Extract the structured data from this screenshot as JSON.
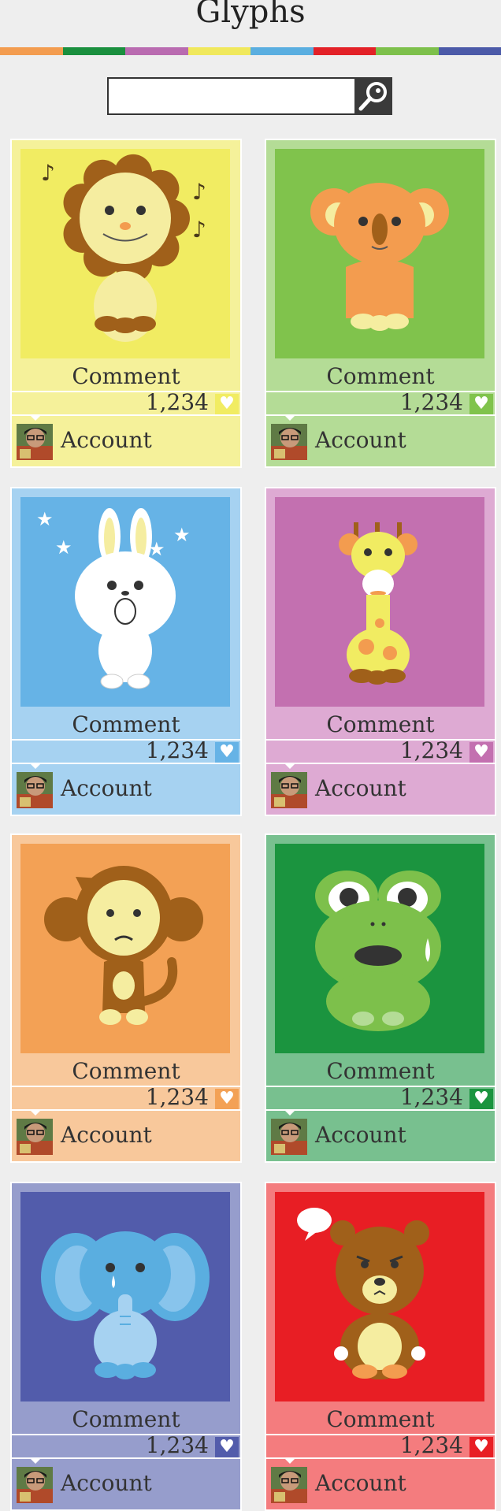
{
  "header": {
    "title": "Glyphs"
  },
  "stripe_colors": [
    "#f39c4f",
    "#1a8f3e",
    "#b96bb0",
    "#f0e85c",
    "#5aaee0",
    "#e32127",
    "#7dc04b",
    "#4b5aa8"
  ],
  "search": {
    "placeholder": "",
    "button_icon": "search-magnifier-icon"
  },
  "cards": [
    {
      "animal": "lion",
      "comment": "Comment",
      "count": "1,234",
      "account": "Account",
      "heart_icon": "heart-icon"
    },
    {
      "animal": "koala",
      "comment": "Comment",
      "count": "1,234",
      "account": "Account",
      "heart_icon": "heart-icon"
    },
    {
      "animal": "rabbit",
      "comment": "Comment",
      "count": "1,234",
      "account": "Account",
      "heart_icon": "heart-icon"
    },
    {
      "animal": "giraffe",
      "comment": "Comment",
      "count": "1,234",
      "account": "Account",
      "heart_icon": "heart-icon"
    },
    {
      "animal": "monkey",
      "comment": "Comment",
      "count": "1,234",
      "account": "Account",
      "heart_icon": "heart-icon"
    },
    {
      "animal": "frog",
      "comment": "Comment",
      "count": "1,234",
      "account": "Account",
      "heart_icon": "heart-icon"
    },
    {
      "animal": "elephant",
      "comment": "Comment",
      "count": "1,234",
      "account": "Account",
      "heart_icon": "heart-icon"
    },
    {
      "animal": "bear",
      "comment": "Comment",
      "count": "1,234",
      "account": "Account",
      "heart_icon": "heart-icon"
    }
  ],
  "card_colors": [
    {
      "light": "#f5f19a",
      "dark": "#f1ec62"
    },
    {
      "light": "#b4dc96",
      "dark": "#80c34c"
    },
    {
      "light": "#a6d2f1",
      "dark": "#66b3e6"
    },
    {
      "light": "#deaad3",
      "dark": "#c370b0"
    },
    {
      "light": "#f8c89b",
      "dark": "#f3a155"
    },
    {
      "light": "#78c08f",
      "dark": "#1b943f"
    },
    {
      "light": "#969dcc",
      "dark": "#525cab"
    },
    {
      "light": "#f47c7e",
      "dark": "#e81e24"
    }
  ]
}
